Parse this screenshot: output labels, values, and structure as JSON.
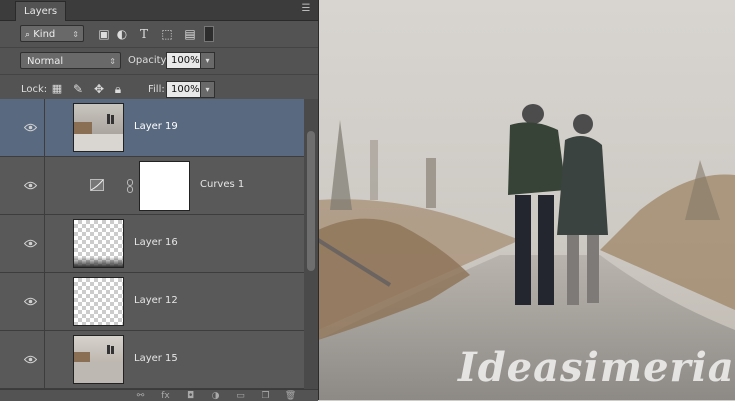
{
  "panel": {
    "tab_label": "Layers",
    "menu_icon": "panel-menu-icon"
  },
  "filter": {
    "kind_label": "Kind",
    "icons": [
      "pixel-filter-icon",
      "adjustment-filter-icon",
      "type-filter-icon",
      "shape-filter-icon",
      "smart-object-filter-icon",
      "filter-toggle-icon"
    ]
  },
  "blend": {
    "mode": "Normal",
    "opacity_label": "Opacity:",
    "opacity_value": "100%"
  },
  "lock": {
    "label": "Lock:",
    "icons": [
      "lock-transparent-icon",
      "lock-image-icon",
      "lock-position-icon",
      "lock-all-icon"
    ],
    "fill_label": "Fill:",
    "fill_value": "100%"
  },
  "layers": [
    {
      "name": "Layer 19",
      "selected": true,
      "type": "photo"
    },
    {
      "name": "Curves 1",
      "selected": false,
      "type": "adjustment"
    },
    {
      "name": "Layer 16",
      "selected": false,
      "type": "transparent-dark"
    },
    {
      "name": "Layer 12",
      "selected": false,
      "type": "transparent"
    },
    {
      "name": "Layer 15",
      "selected": false,
      "type": "photo-small"
    }
  ],
  "footer_icons": [
    "link-layers-icon",
    "fx-icon",
    "add-mask-icon",
    "new-adjustment-icon",
    "new-group-icon",
    "new-layer-icon",
    "delete-layer-icon"
  ],
  "watermark_text": "Ideasimeria",
  "colors": {
    "selected_row": "#596a80",
    "panel_bg": "#535353"
  }
}
